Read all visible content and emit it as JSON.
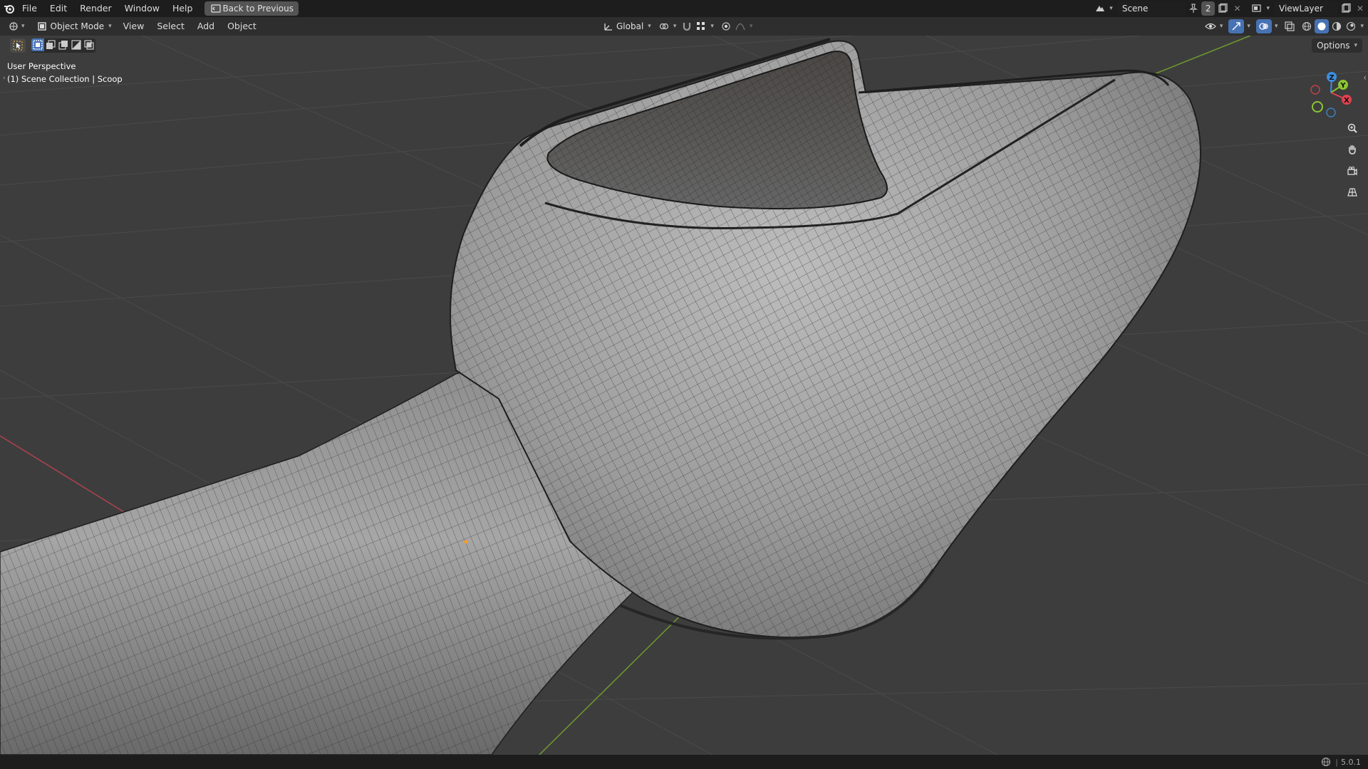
{
  "menu": {
    "file": "File",
    "edit": "Edit",
    "render": "Render",
    "window": "Window",
    "help": "Help",
    "back": "Back to Previous"
  },
  "scene": {
    "name": "Scene",
    "users": "2",
    "view_layer": "ViewLayer"
  },
  "header": {
    "mode": "Object Mode",
    "view": "View",
    "select": "Select",
    "add": "Add",
    "object": "Object",
    "transform_orientation": "Global",
    "options": "Options"
  },
  "viewport": {
    "perspective": "User Perspective",
    "collection": "(1) Scene Collection | Scoop"
  },
  "gizmo": {
    "x": "X",
    "y": "Y",
    "z": "Z"
  },
  "status": {
    "version": "5.0.1"
  },
  "colors": {
    "accent": "#4772b3",
    "axis_x": "#e0424f",
    "axis_y": "#8bc532",
    "axis_z": "#3d8ee0",
    "origin": "#ff9b1a"
  }
}
